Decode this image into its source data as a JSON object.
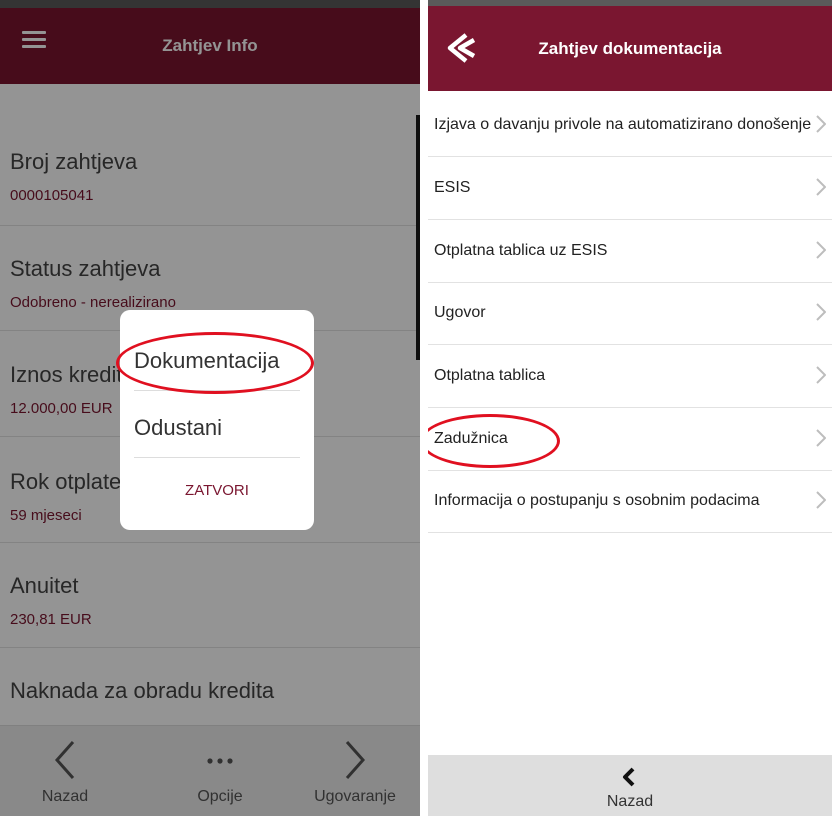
{
  "left_screen": {
    "title": "Zahtjev Info",
    "fields": [
      {
        "label": "Broj zahtjeva",
        "value": "0000105041"
      },
      {
        "label": "Status zahtjeva",
        "value": "Odobreno - nerealizirano"
      },
      {
        "label": "Iznos kredita",
        "value": "12.000,00 EUR"
      },
      {
        "label": "Rok otplate",
        "value": "59 mjeseci"
      },
      {
        "label": "Anuitet",
        "value": "230,81 EUR"
      },
      {
        "label": "Naknada za obradu kredita",
        "value": ""
      }
    ],
    "dialog": {
      "items": [
        "Dokumentacija",
        "Odustani"
      ],
      "close_label": "ZATVORI"
    },
    "bottom_nav": [
      {
        "label": "Nazad",
        "icon": "chevron-left-icon"
      },
      {
        "label": "Opcije",
        "icon": "more-dots-icon"
      },
      {
        "label": "Ugovaranje",
        "icon": "chevron-right-icon"
      }
    ]
  },
  "right_screen": {
    "title": "Zahtjev dokumentacija",
    "documents": [
      "Izjava o davanju privole na automatizirano donošenje odluka",
      "ESIS",
      "Otplatna tablica uz ESIS",
      "Ugovor",
      "Otplatna tablica",
      "Zadužnica",
      "Informacija o postupanju s osobnim podacima"
    ],
    "bottom_button": "Nazad"
  },
  "colors": {
    "brand": "#7a1630",
    "highlight": "#e01020"
  }
}
